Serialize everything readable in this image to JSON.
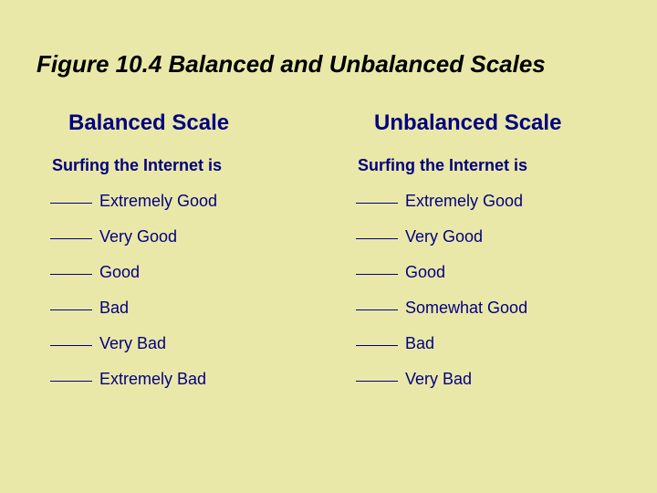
{
  "title": "Figure 10.4  Balanced and Unbalanced  Scales",
  "left": {
    "header": "Balanced Scale",
    "lead": "Surfing the Internet is",
    "items": [
      "Extremely Good",
      "Very Good",
      "Good",
      "Bad",
      "Very Bad",
      "Extremely Bad"
    ]
  },
  "right": {
    "header": "Unbalanced Scale",
    "lead": "Surfing the Internet is",
    "items": [
      "Extremely Good",
      "Very Good",
      "Good",
      "Somewhat Good",
      "Bad",
      "Very Bad"
    ]
  }
}
